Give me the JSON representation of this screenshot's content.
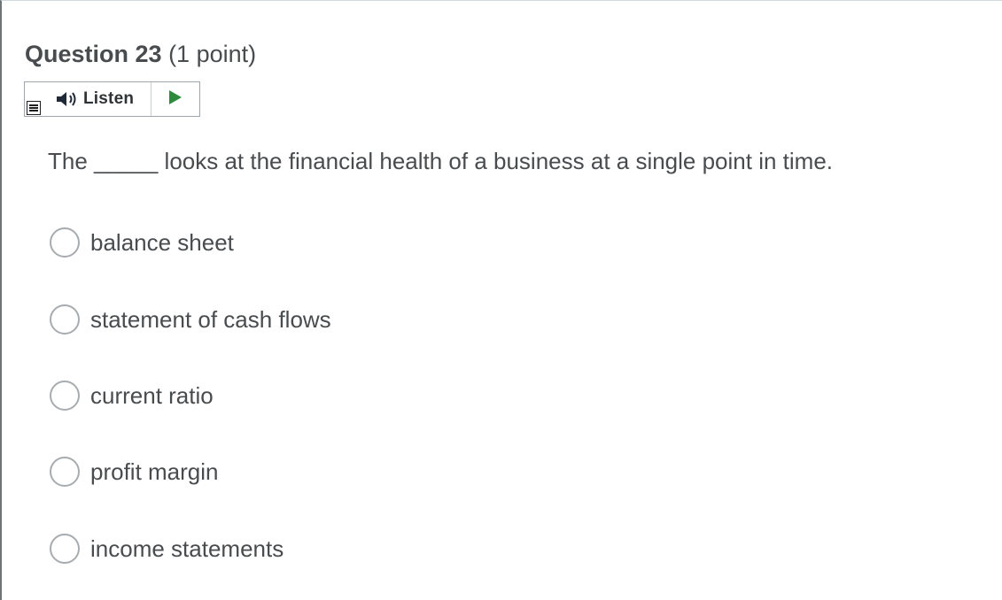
{
  "question": {
    "title": "Question 23",
    "points": "(1 point)"
  },
  "listen_widget": {
    "label": "Listen",
    "menu_icon": "menu-icon",
    "speaker_icon": "speaker-icon",
    "play_icon": "play-icon",
    "play_color": "#2e8b3e"
  },
  "prompt": "The _____ looks at the financial health of a business at a single point in time.",
  "options": [
    {
      "label": "balance sheet",
      "selected": false
    },
    {
      "label": "statement of cash flows",
      "selected": false
    },
    {
      "label": "current ratio",
      "selected": false
    },
    {
      "label": "profit margin",
      "selected": false
    },
    {
      "label": "income statements",
      "selected": false
    }
  ]
}
